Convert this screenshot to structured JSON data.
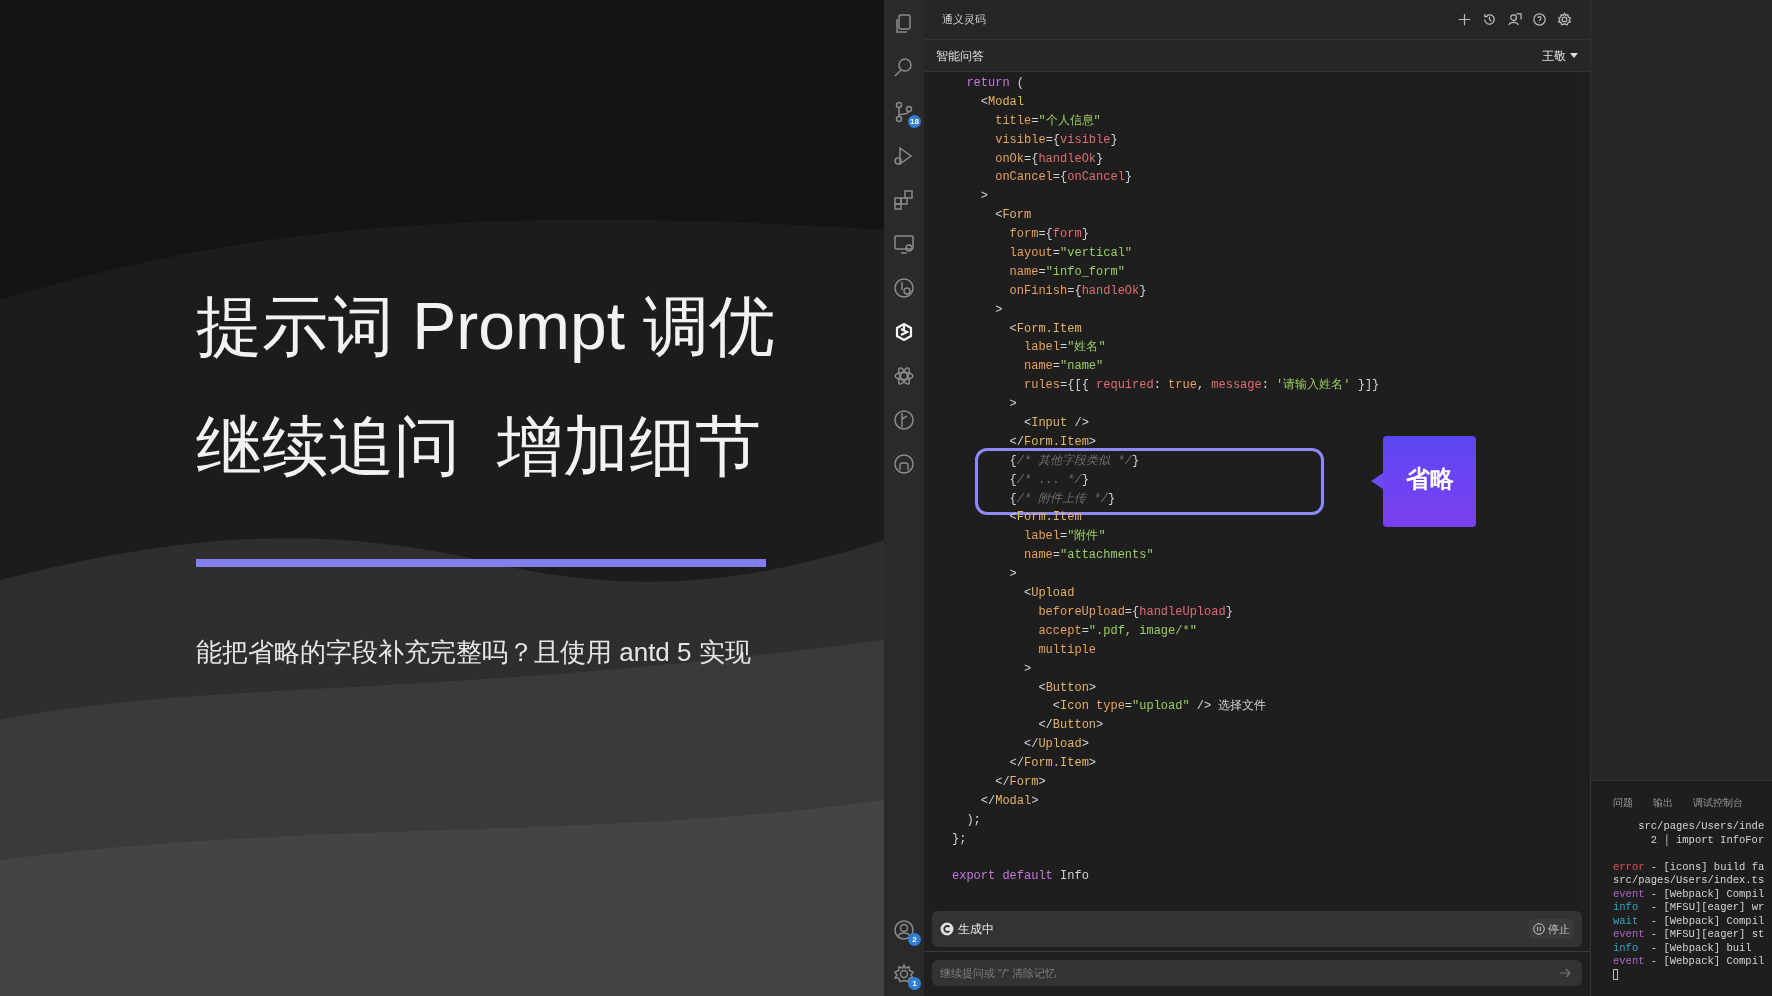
{
  "slide": {
    "title_lines": [
      "提示词 Prompt 调优",
      "继续追问  增加细节"
    ],
    "subtitle": "能把省略的字段补充完整吗？且使用 antd 5 实现"
  },
  "activity_bar": {
    "top": [
      {
        "kind": "files",
        "selected": false
      },
      {
        "kind": "search",
        "selected": false
      },
      {
        "kind": "branch",
        "selected": false,
        "badge": "18"
      },
      {
        "kind": "run",
        "selected": false
      },
      {
        "kind": "blocks",
        "selected": false
      },
      {
        "kind": "monitor",
        "selected": false
      },
      {
        "kind": "clock",
        "selected": false
      },
      {
        "kind": "spark",
        "selected": true
      },
      {
        "kind": "atom",
        "selected": false
      },
      {
        "kind": "graph",
        "selected": false
      },
      {
        "kind": "cat",
        "selected": false
      }
    ],
    "bottom": [
      {
        "kind": "account",
        "badge": "2"
      },
      {
        "kind": "gear",
        "badge": "1"
      }
    ]
  },
  "assistant": {
    "title": "通义灵码",
    "toolbar": [
      {
        "kind": "plus"
      },
      {
        "kind": "history"
      },
      {
        "kind": "person"
      },
      {
        "kind": "help"
      },
      {
        "kind": "gear"
      }
    ],
    "header": "智能问答",
    "user": "王敬",
    "code": [
      {
        "highlighted": false,
        "lines": [
          {
            "tokens": [
              {
                "kind": "kw",
                "t": "  return "
              },
              {
                "kind": "p",
                "t": "("
              }
            ]
          },
          {
            "tokens": [
              {
                "kind": "p",
                "t": "    <"
              },
              {
                "kind": "tag",
                "t": "Modal"
              }
            ]
          },
          {
            "tokens": [
              {
                "kind": "attr",
                "t": "      title"
              },
              {
                "kind": "p",
                "t": "="
              },
              {
                "kind": "str",
                "t": "\"个人信息\""
              }
            ]
          },
          {
            "tokens": [
              {
                "kind": "attr",
                "t": "      visible"
              },
              {
                "kind": "p",
                "t": "={"
              },
              {
                "kind": "expr",
                "t": "visible"
              },
              {
                "kind": "p",
                "t": "}"
              }
            ]
          },
          {
            "tokens": [
              {
                "kind": "attr",
                "t": "      onOk"
              },
              {
                "kind": "p",
                "t": "={"
              },
              {
                "kind": "expr",
                "t": "handleOk"
              },
              {
                "kind": "p",
                "t": "}"
              }
            ]
          },
          {
            "tokens": [
              {
                "kind": "attr",
                "t": "      onCancel"
              },
              {
                "kind": "p",
                "t": "={"
              },
              {
                "kind": "expr",
                "t": "onCancel"
              },
              {
                "kind": "p",
                "t": "}"
              }
            ]
          },
          {
            "tokens": [
              {
                "kind": "p",
                "t": "    >"
              }
            ]
          },
          {
            "tokens": [
              {
                "kind": "p",
                "t": "      <"
              },
              {
                "kind": "tag",
                "t": "Form"
              }
            ]
          },
          {
            "tokens": [
              {
                "kind": "attr",
                "t": "        form"
              },
              {
                "kind": "p",
                "t": "={"
              },
              {
                "kind": "expr",
                "t": "form"
              },
              {
                "kind": "p",
                "t": "}"
              }
            ]
          },
          {
            "tokens": [
              {
                "kind": "attr",
                "t": "        layout"
              },
              {
                "kind": "p",
                "t": "="
              },
              {
                "kind": "str",
                "t": "\"vertical\""
              }
            ]
          },
          {
            "tokens": [
              {
                "kind": "attr",
                "t": "        name"
              },
              {
                "kind": "p",
                "t": "="
              },
              {
                "kind": "str",
                "t": "\"info_form\""
              }
            ]
          },
          {
            "tokens": [
              {
                "kind": "attr",
                "t": "        onFinish"
              },
              {
                "kind": "p",
                "t": "={"
              },
              {
                "kind": "expr",
                "t": "handleOk"
              },
              {
                "kind": "p",
                "t": "}"
              }
            ]
          },
          {
            "tokens": [
              {
                "kind": "p",
                "t": "      >"
              }
            ]
          },
          {
            "tokens": [
              {
                "kind": "p",
                "t": "        <"
              },
              {
                "kind": "tag",
                "t": "Form.Item"
              }
            ]
          },
          {
            "tokens": [
              {
                "kind": "attr",
                "t": "          label"
              },
              {
                "kind": "p",
                "t": "="
              },
              {
                "kind": "str",
                "t": "\"姓名\""
              }
            ]
          },
          {
            "tokens": [
              {
                "kind": "attr",
                "t": "          name"
              },
              {
                "kind": "p",
                "t": "="
              },
              {
                "kind": "str",
                "t": "\"name\""
              }
            ]
          },
          {
            "tokens": [
              {
                "kind": "attr",
                "t": "          rules"
              },
              {
                "kind": "p",
                "t": "={[{ "
              },
              {
                "kind": "expr",
                "t": "required"
              },
              {
                "kind": "p",
                "t": ": "
              },
              {
                "kind": "attr",
                "t": "true"
              },
              {
                "kind": "p",
                "t": ", "
              },
              {
                "kind": "expr",
                "t": "message"
              },
              {
                "kind": "p",
                "t": ": "
              },
              {
                "kind": "str",
                "t": "'请输入姓名'"
              },
              {
                "kind": "p",
                "t": " }]}"
              }
            ]
          },
          {
            "tokens": [
              {
                "kind": "p",
                "t": "        >"
              }
            ]
          },
          {
            "tokens": [
              {
                "kind": "p",
                "t": "          <"
              },
              {
                "kind": "tag",
                "t": "Input"
              },
              {
                "kind": "p",
                "t": " />"
              }
            ]
          },
          {
            "tokens": [
              {
                "kind": "p",
                "t": "        </"
              },
              {
                "kind": "tag",
                "t": "Form.Item"
              },
              {
                "kind": "p",
                "t": ">"
              }
            ]
          }
        ]
      },
      {
        "highlighted": true,
        "lines": [
          {
            "tokens": [
              {
                "kind": "p",
                "t": "        {"
              },
              {
                "kind": "cm",
                "t": "/* 其他字段类似 */"
              },
              {
                "kind": "p",
                "t": "}"
              }
            ]
          },
          {
            "tokens": [
              {
                "kind": "p",
                "t": "        {"
              },
              {
                "kind": "cm",
                "t": "/* ... */"
              },
              {
                "kind": "p",
                "t": "}"
              }
            ]
          },
          {
            "tokens": [
              {
                "kind": "p",
                "t": "        {"
              },
              {
                "kind": "cm",
                "t": "/* 附件上传 */"
              },
              {
                "kind": "p",
                "t": "}"
              }
            ]
          }
        ]
      },
      {
        "highlighted": false,
        "lines": [
          {
            "tokens": [
              {
                "kind": "p",
                "t": "        <"
              },
              {
                "kind": "tag",
                "t": "Form.Item"
              }
            ]
          },
          {
            "tokens": [
              {
                "kind": "attr",
                "t": "          label"
              },
              {
                "kind": "p",
                "t": "="
              },
              {
                "kind": "str",
                "t": "\"附件\""
              }
            ]
          },
          {
            "tokens": [
              {
                "kind": "attr",
                "t": "          name"
              },
              {
                "kind": "p",
                "t": "="
              },
              {
                "kind": "str",
                "t": "\"attachments\""
              }
            ]
          },
          {
            "tokens": [
              {
                "kind": "p",
                "t": "        >"
              }
            ]
          },
          {
            "tokens": [
              {
                "kind": "p",
                "t": "          <"
              },
              {
                "kind": "tag",
                "t": "Upload"
              }
            ]
          },
          {
            "tokens": [
              {
                "kind": "attr",
                "t": "            beforeUpload"
              },
              {
                "kind": "p",
                "t": "={"
              },
              {
                "kind": "expr",
                "t": "handleUpload"
              },
              {
                "kind": "p",
                "t": "}"
              }
            ]
          },
          {
            "tokens": [
              {
                "kind": "attr",
                "t": "            accept"
              },
              {
                "kind": "p",
                "t": "="
              },
              {
                "kind": "str",
                "t": "\".pdf, image/*\""
              }
            ]
          },
          {
            "tokens": [
              {
                "kind": "attr",
                "t": "            multiple"
              }
            ]
          },
          {
            "tokens": [
              {
                "kind": "p",
                "t": "          >"
              }
            ]
          },
          {
            "tokens": [
              {
                "kind": "p",
                "t": "            <"
              },
              {
                "kind": "tag",
                "t": "Button"
              },
              {
                "kind": "p",
                "t": ">"
              }
            ]
          },
          {
            "tokens": [
              {
                "kind": "p",
                "t": "              <"
              },
              {
                "kind": "tag",
                "t": "Icon "
              },
              {
                "kind": "attr",
                "t": "type"
              },
              {
                "kind": "p",
                "t": "="
              },
              {
                "kind": "str",
                "t": "\"upload\""
              },
              {
                "kind": "p",
                "t": " /> 选择文件"
              }
            ]
          },
          {
            "tokens": [
              {
                "kind": "p",
                "t": "            </"
              },
              {
                "kind": "tag",
                "t": "Button"
              },
              {
                "kind": "p",
                "t": ">"
              }
            ]
          },
          {
            "tokens": [
              {
                "kind": "p",
                "t": "          </"
              },
              {
                "kind": "tag",
                "t": "Upload"
              },
              {
                "kind": "p",
                "t": ">"
              }
            ]
          },
          {
            "tokens": [
              {
                "kind": "p",
                "t": "        </"
              },
              {
                "kind": "tag",
                "t": "Form.Item"
              },
              {
                "kind": "p",
                "t": ">"
              }
            ]
          },
          {
            "tokens": [
              {
                "kind": "p",
                "t": "      </"
              },
              {
                "kind": "tag",
                "t": "Form"
              },
              {
                "kind": "p",
                "t": ">"
              }
            ]
          },
          {
            "tokens": [
              {
                "kind": "p",
                "t": "    </"
              },
              {
                "kind": "tag",
                "t": "Modal"
              },
              {
                "kind": "p",
                "t": ">"
              }
            ]
          },
          {
            "tokens": [
              {
                "kind": "p",
                "t": "  );"
              }
            ]
          },
          {
            "tokens": [
              {
                "kind": "p",
                "t": "};"
              }
            ]
          },
          {
            "kind": "blank"
          },
          {
            "tokens": [
              {
                "kind": "kw",
                "t": "export default "
              },
              {
                "kind": "p",
                "t": "Info"
              }
            ]
          }
        ]
      }
    ],
    "callout": "省略",
    "status": "生成中",
    "stop": "停止",
    "input_placeholder": "继续提问或 \"/\" 清除记忆"
  },
  "terminal": {
    "tabs": [
      "问题",
      "输出",
      "调试控制台"
    ],
    "lines": [
      {
        "tokens": [
          {
            "kind": "p",
            "t": "    src/pages/Users/inde"
          }
        ]
      },
      {
        "tokens": [
          {
            "kind": "p",
            "t": "      2 │ import InfoFor"
          }
        ]
      },
      {
        "kind": "blank"
      },
      {
        "tokens": [
          {
            "kind": "error",
            "t": "error"
          },
          {
            "kind": "p",
            "t": " - [icons] build fa"
          }
        ]
      },
      {
        "tokens": [
          {
            "kind": "p",
            "t": "src/pages/Users/index.ts"
          }
        ]
      },
      {
        "tokens": [
          {
            "kind": "event",
            "t": "event"
          },
          {
            "kind": "p",
            "t": " - [Webpack] Compil"
          }
        ]
      },
      {
        "tokens": [
          {
            "kind": "info",
            "t": "info"
          },
          {
            "kind": "p",
            "t": "  - [MFSU][eager] wr"
          }
        ]
      },
      {
        "tokens": [
          {
            "kind": "info",
            "t": "wait"
          },
          {
            "kind": "p",
            "t": "  - [Webpack] Compil"
          }
        ]
      },
      {
        "tokens": [
          {
            "kind": "event",
            "t": "event"
          },
          {
            "kind": "p",
            "t": " - [MFSU][eager] st"
          }
        ]
      },
      {
        "tokens": [
          {
            "kind": "info",
            "t": "info"
          },
          {
            "kind": "p",
            "t": "  - [Webpack] buil"
          }
        ]
      },
      {
        "tokens": [
          {
            "kind": "event",
            "t": "event"
          },
          {
            "kind": "p",
            "t": " - [Webpack] Compil"
          }
        ]
      }
    ]
  }
}
